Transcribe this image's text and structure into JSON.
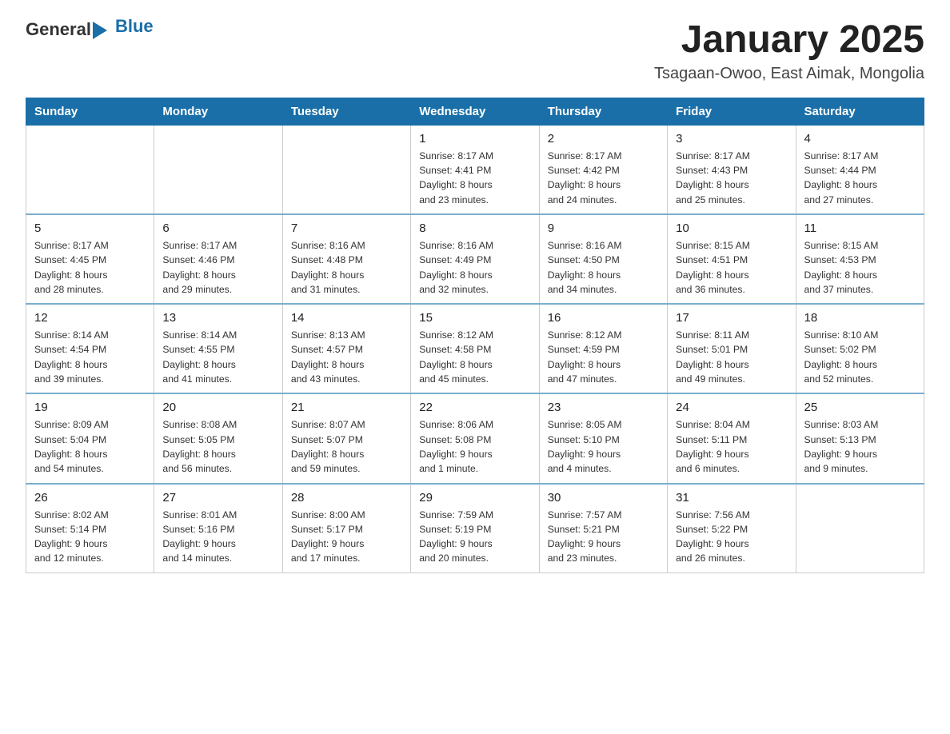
{
  "logo": {
    "general": "General",
    "blue": "Blue"
  },
  "header": {
    "month": "January 2025",
    "location": "Tsagaan-Owoo, East Aimak, Mongolia"
  },
  "weekdays": [
    "Sunday",
    "Monday",
    "Tuesday",
    "Wednesday",
    "Thursday",
    "Friday",
    "Saturday"
  ],
  "weeks": [
    [
      {
        "day": "",
        "info": ""
      },
      {
        "day": "",
        "info": ""
      },
      {
        "day": "",
        "info": ""
      },
      {
        "day": "1",
        "info": "Sunrise: 8:17 AM\nSunset: 4:41 PM\nDaylight: 8 hours\nand 23 minutes."
      },
      {
        "day": "2",
        "info": "Sunrise: 8:17 AM\nSunset: 4:42 PM\nDaylight: 8 hours\nand 24 minutes."
      },
      {
        "day": "3",
        "info": "Sunrise: 8:17 AM\nSunset: 4:43 PM\nDaylight: 8 hours\nand 25 minutes."
      },
      {
        "day": "4",
        "info": "Sunrise: 8:17 AM\nSunset: 4:44 PM\nDaylight: 8 hours\nand 27 minutes."
      }
    ],
    [
      {
        "day": "5",
        "info": "Sunrise: 8:17 AM\nSunset: 4:45 PM\nDaylight: 8 hours\nand 28 minutes."
      },
      {
        "day": "6",
        "info": "Sunrise: 8:17 AM\nSunset: 4:46 PM\nDaylight: 8 hours\nand 29 minutes."
      },
      {
        "day": "7",
        "info": "Sunrise: 8:16 AM\nSunset: 4:48 PM\nDaylight: 8 hours\nand 31 minutes."
      },
      {
        "day": "8",
        "info": "Sunrise: 8:16 AM\nSunset: 4:49 PM\nDaylight: 8 hours\nand 32 minutes."
      },
      {
        "day": "9",
        "info": "Sunrise: 8:16 AM\nSunset: 4:50 PM\nDaylight: 8 hours\nand 34 minutes."
      },
      {
        "day": "10",
        "info": "Sunrise: 8:15 AM\nSunset: 4:51 PM\nDaylight: 8 hours\nand 36 minutes."
      },
      {
        "day": "11",
        "info": "Sunrise: 8:15 AM\nSunset: 4:53 PM\nDaylight: 8 hours\nand 37 minutes."
      }
    ],
    [
      {
        "day": "12",
        "info": "Sunrise: 8:14 AM\nSunset: 4:54 PM\nDaylight: 8 hours\nand 39 minutes."
      },
      {
        "day": "13",
        "info": "Sunrise: 8:14 AM\nSunset: 4:55 PM\nDaylight: 8 hours\nand 41 minutes."
      },
      {
        "day": "14",
        "info": "Sunrise: 8:13 AM\nSunset: 4:57 PM\nDaylight: 8 hours\nand 43 minutes."
      },
      {
        "day": "15",
        "info": "Sunrise: 8:12 AM\nSunset: 4:58 PM\nDaylight: 8 hours\nand 45 minutes."
      },
      {
        "day": "16",
        "info": "Sunrise: 8:12 AM\nSunset: 4:59 PM\nDaylight: 8 hours\nand 47 minutes."
      },
      {
        "day": "17",
        "info": "Sunrise: 8:11 AM\nSunset: 5:01 PM\nDaylight: 8 hours\nand 49 minutes."
      },
      {
        "day": "18",
        "info": "Sunrise: 8:10 AM\nSunset: 5:02 PM\nDaylight: 8 hours\nand 52 minutes."
      }
    ],
    [
      {
        "day": "19",
        "info": "Sunrise: 8:09 AM\nSunset: 5:04 PM\nDaylight: 8 hours\nand 54 minutes."
      },
      {
        "day": "20",
        "info": "Sunrise: 8:08 AM\nSunset: 5:05 PM\nDaylight: 8 hours\nand 56 minutes."
      },
      {
        "day": "21",
        "info": "Sunrise: 8:07 AM\nSunset: 5:07 PM\nDaylight: 8 hours\nand 59 minutes."
      },
      {
        "day": "22",
        "info": "Sunrise: 8:06 AM\nSunset: 5:08 PM\nDaylight: 9 hours\nand 1 minute."
      },
      {
        "day": "23",
        "info": "Sunrise: 8:05 AM\nSunset: 5:10 PM\nDaylight: 9 hours\nand 4 minutes."
      },
      {
        "day": "24",
        "info": "Sunrise: 8:04 AM\nSunset: 5:11 PM\nDaylight: 9 hours\nand 6 minutes."
      },
      {
        "day": "25",
        "info": "Sunrise: 8:03 AM\nSunset: 5:13 PM\nDaylight: 9 hours\nand 9 minutes."
      }
    ],
    [
      {
        "day": "26",
        "info": "Sunrise: 8:02 AM\nSunset: 5:14 PM\nDaylight: 9 hours\nand 12 minutes."
      },
      {
        "day": "27",
        "info": "Sunrise: 8:01 AM\nSunset: 5:16 PM\nDaylight: 9 hours\nand 14 minutes."
      },
      {
        "day": "28",
        "info": "Sunrise: 8:00 AM\nSunset: 5:17 PM\nDaylight: 9 hours\nand 17 minutes."
      },
      {
        "day": "29",
        "info": "Sunrise: 7:59 AM\nSunset: 5:19 PM\nDaylight: 9 hours\nand 20 minutes."
      },
      {
        "day": "30",
        "info": "Sunrise: 7:57 AM\nSunset: 5:21 PM\nDaylight: 9 hours\nand 23 minutes."
      },
      {
        "day": "31",
        "info": "Sunrise: 7:56 AM\nSunset: 5:22 PM\nDaylight: 9 hours\nand 26 minutes."
      },
      {
        "day": "",
        "info": ""
      }
    ]
  ]
}
